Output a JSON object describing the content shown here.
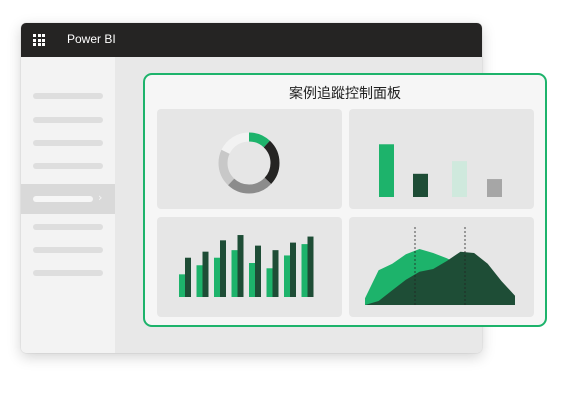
{
  "app": {
    "title": "Power BI"
  },
  "icons": {
    "app_launcher": "waffle-grid-icon",
    "nav_expand": "chevron-right-icon"
  },
  "colors": {
    "accent": "#1db36b",
    "dark_green": "#1e4d36",
    "mint": "#cfe9dd",
    "gray": "#a6a6a6",
    "titlebar": "#252423"
  },
  "sidebar": {
    "items": [
      {
        "selected": false
      },
      {
        "selected": false
      },
      {
        "selected": false
      },
      {
        "selected": true
      },
      {
        "selected": false
      },
      {
        "selected": false
      },
      {
        "selected": false
      }
    ]
  },
  "dashboard": {
    "title": "案例追蹤控制面板"
  },
  "chart_data": [
    {
      "type": "pie",
      "variant": "donut",
      "values": [
        12,
        25,
        25,
        20,
        18
      ],
      "colors": [
        "#1db36b",
        "#252423",
        "#8c8c8c",
        "#c8c8c8",
        "#f2f2f2"
      ]
    },
    {
      "type": "bar",
      "values": [
        100,
        44,
        68,
        34
      ],
      "colors": [
        "#1db36b",
        "#1e4d36",
        "#cfe9dd",
        "#a6a6a6"
      ],
      "ylim": [
        0,
        110
      ]
    },
    {
      "type": "bar",
      "grouped": true,
      "series": [
        {
          "values": [
            30,
            42,
            52,
            62,
            45,
            38,
            55,
            70
          ],
          "color": "#1db36b"
        },
        {
          "values": [
            52,
            60,
            75,
            82,
            68,
            62,
            72,
            80
          ],
          "color": "#1e4d36"
        }
      ],
      "ylim": [
        0,
        90
      ]
    },
    {
      "type": "area",
      "series": [
        {
          "values": [
            10,
            52,
            62,
            76,
            84,
            78,
            70,
            60,
            44,
            30,
            18,
            8
          ],
          "color": "#1db36b"
        },
        {
          "values": [
            0,
            6,
            22,
            38,
            50,
            54,
            66,
            80,
            78,
            62,
            36,
            14
          ],
          "color": "#1e4d36"
        }
      ],
      "ylim": [
        0,
        90
      ]
    }
  ]
}
